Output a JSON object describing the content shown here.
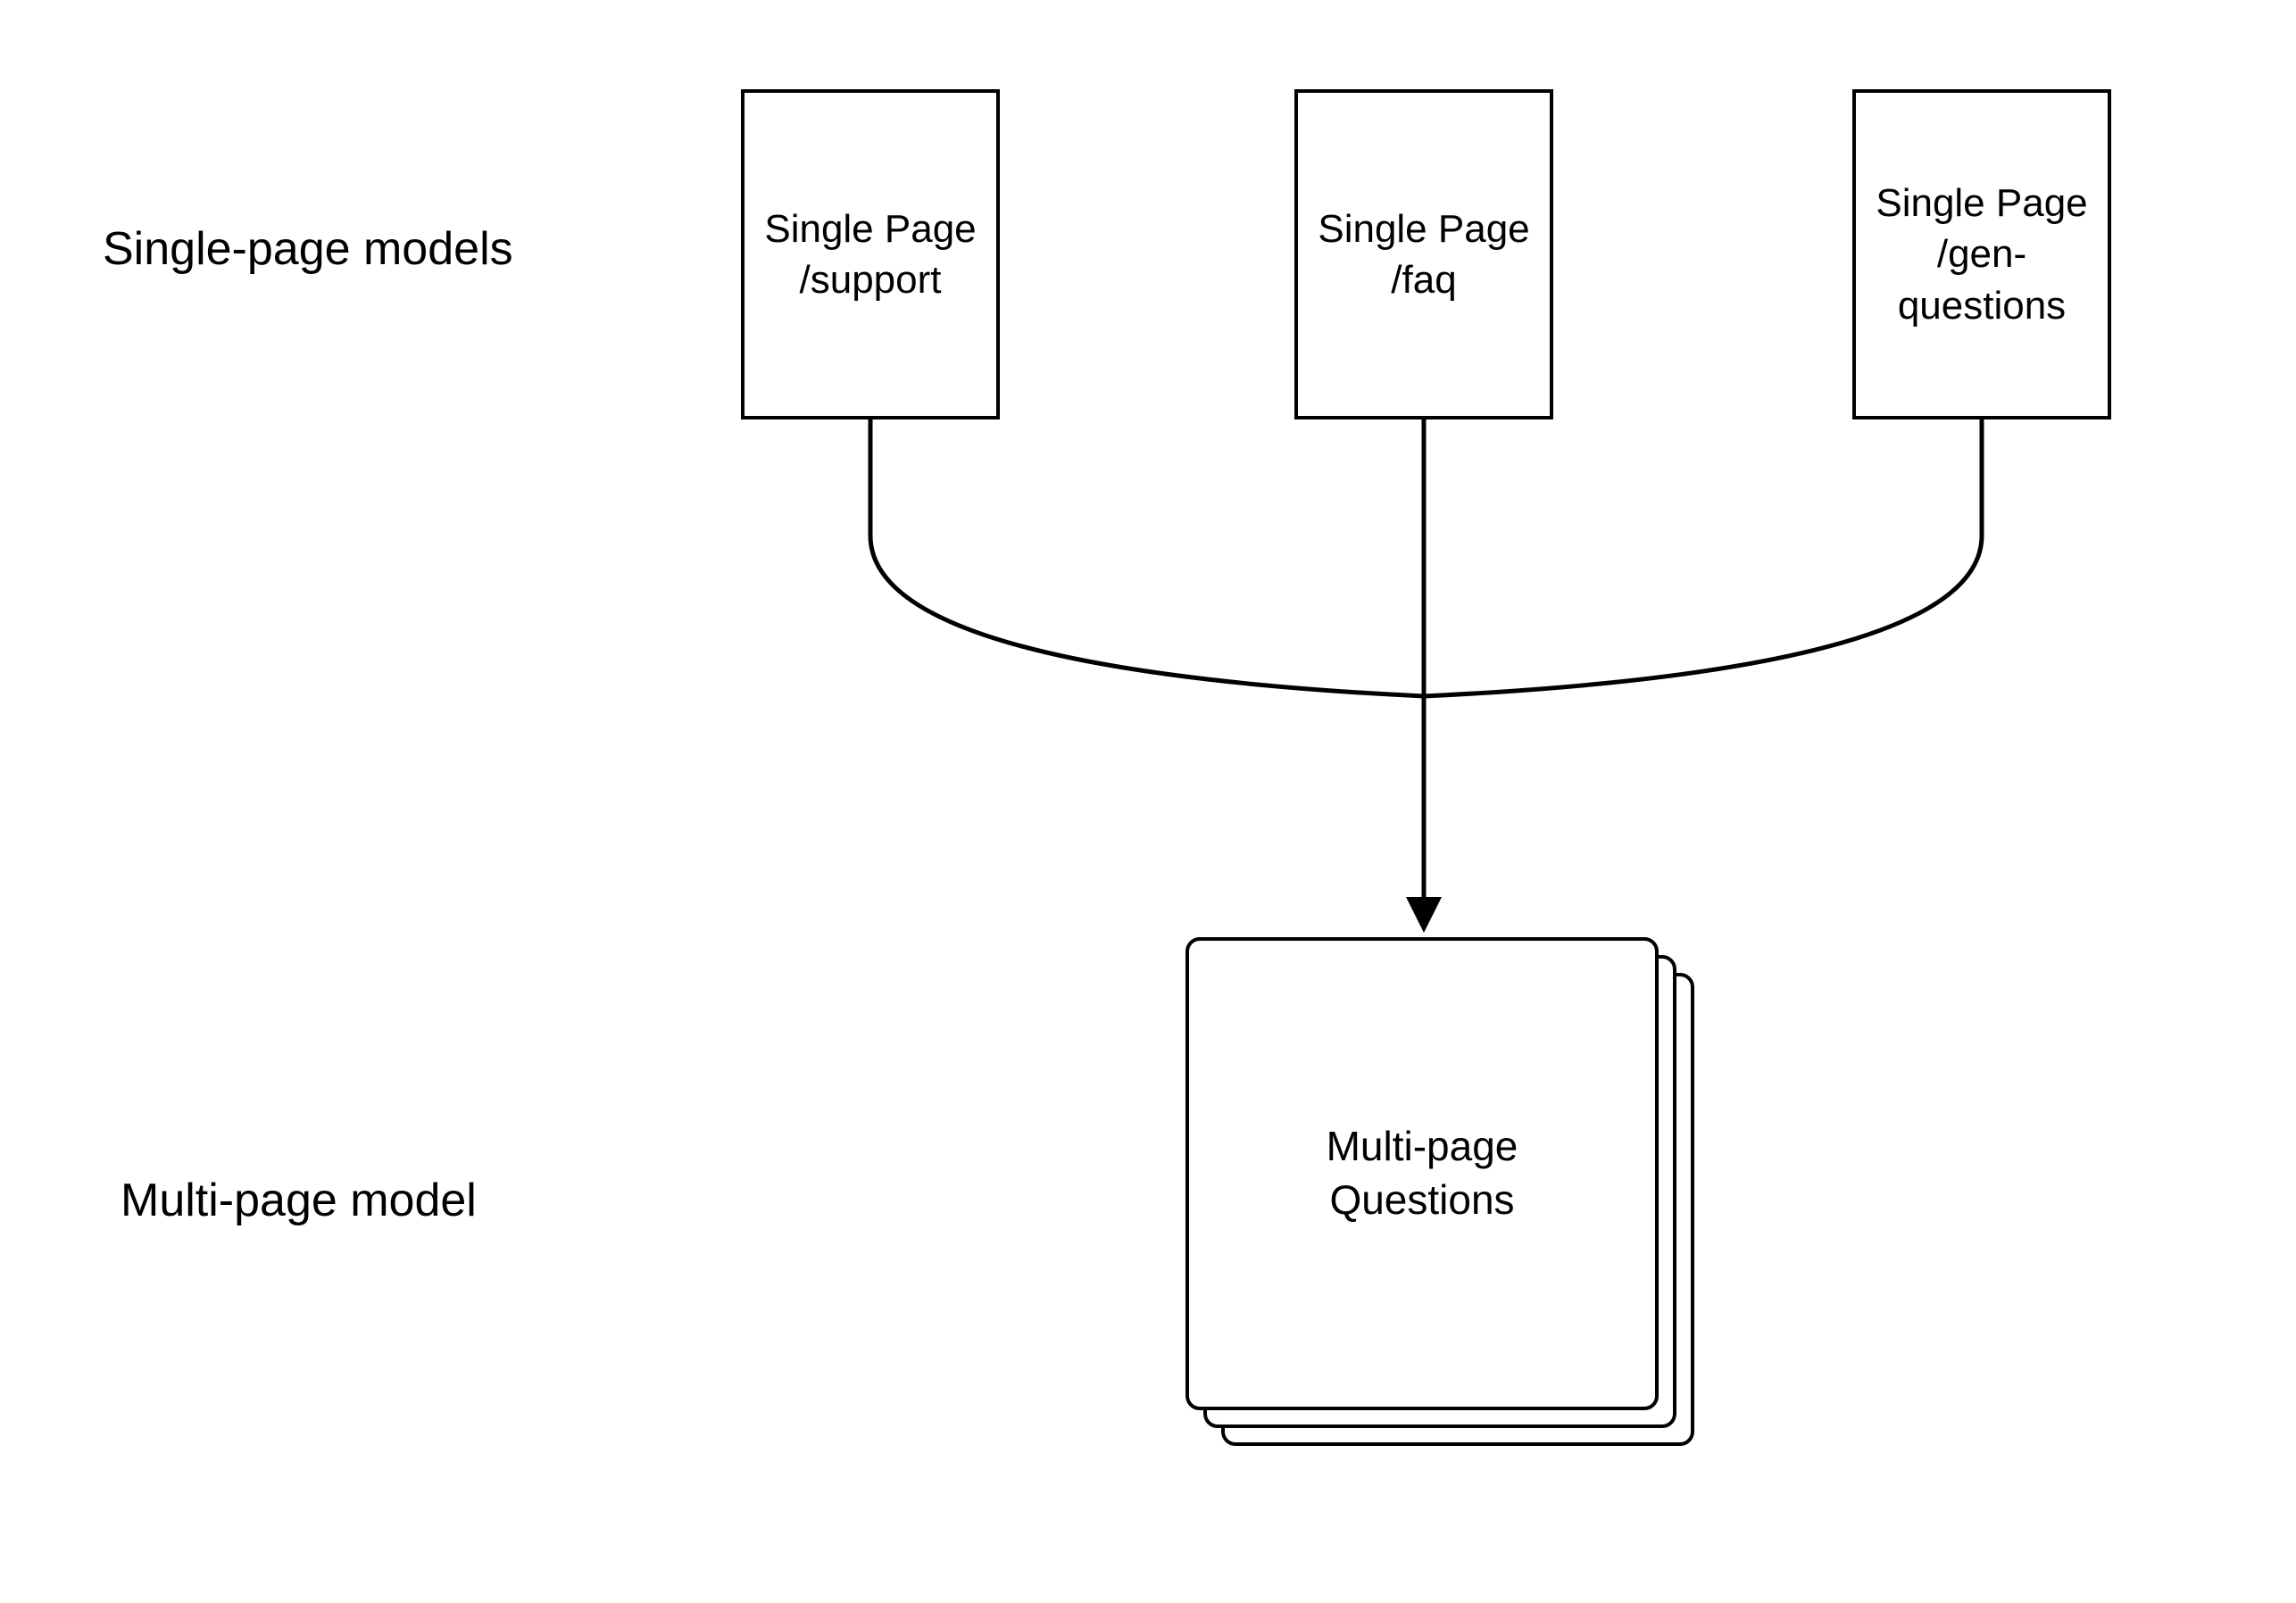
{
  "labels": {
    "top_section": "Single-page models",
    "bottom_section": "Multi-page model"
  },
  "boxes": {
    "support": {
      "line1": "Single Page",
      "line2": "/support"
    },
    "faq": {
      "line1": "Single Page",
      "line2": "/faq"
    },
    "genq": {
      "line1": "Single Page",
      "line2": "/gen-questions"
    },
    "multi": {
      "line1": "Multi-page",
      "line2": "Questions"
    }
  }
}
